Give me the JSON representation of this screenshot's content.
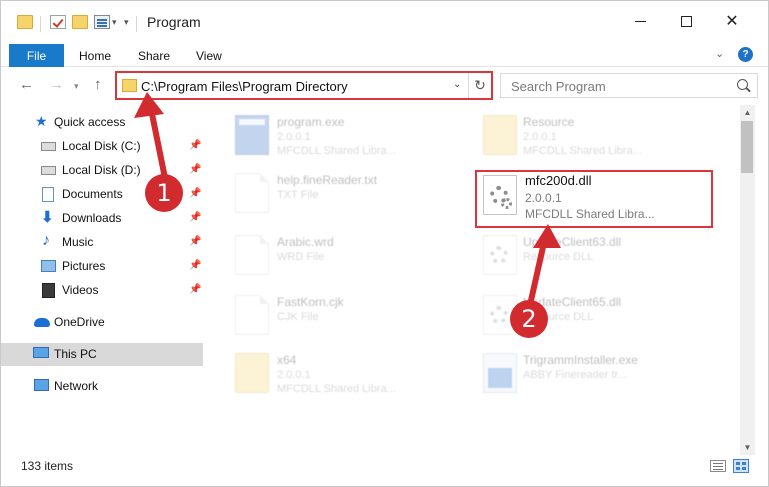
{
  "titlebar": {
    "title": "Program",
    "qa_dropdown": "▾"
  },
  "ribbon": {
    "tabs": [
      "File",
      "Home",
      "Share",
      "View"
    ],
    "help": "?"
  },
  "address": {
    "path": "C:\\Program Files\\Program Directory",
    "search_placeholder": "Search Program"
  },
  "sidebar": {
    "items": [
      {
        "label": "Quick access",
        "icon": "star-icon",
        "pinned": false
      },
      {
        "label": "Local Disk (C:)",
        "icon": "drive-icon",
        "pinned": true
      },
      {
        "label": "Local Disk (D:)",
        "icon": "drive-icon",
        "pinned": true
      },
      {
        "label": "Documents",
        "icon": "documents-icon",
        "pinned": true
      },
      {
        "label": "Downloads",
        "icon": "download-icon",
        "pinned": true
      },
      {
        "label": "Music",
        "icon": "music-icon",
        "pinned": true
      },
      {
        "label": "Pictures",
        "icon": "pictures-icon",
        "pinned": true
      },
      {
        "label": "Videos",
        "icon": "videos-icon",
        "pinned": true
      },
      {
        "label": "OneDrive",
        "icon": "cloud-icon",
        "pinned": false
      },
      {
        "label": "This PC",
        "icon": "computer-icon",
        "pinned": false,
        "selected": true
      },
      {
        "label": "Network",
        "icon": "network-icon",
        "pinned": false
      }
    ]
  },
  "files": [
    {
      "name": "program.exe",
      "meta1": "2.0.0.1",
      "meta2": "MFCDLL Shared Libra...",
      "icon": "exe-icon"
    },
    {
      "name": "Resource",
      "meta1": "2.0.0.1",
      "meta2": "MFCDLL Shared Libra...",
      "icon": "folder-icon"
    },
    {
      "name": "help.fineReader.txt",
      "meta1": "TXT File",
      "meta2": "",
      "icon": "document-icon"
    },
    {
      "name": "mfc200d.dll",
      "meta1": "2.0.0.1",
      "meta2": "MFCDLL Shared Libra...",
      "icon": "dll-gear-icon",
      "highlighted": true
    },
    {
      "name": "Arabic.wrd",
      "meta1": "WRD File",
      "meta2": "",
      "icon": "document-icon"
    },
    {
      "name": "UpdateClient63.dll",
      "meta1": "Resource DLL",
      "meta2": "",
      "icon": "dll-gear-icon"
    },
    {
      "name": "FastKorn.cjk",
      "meta1": "CJK File",
      "meta2": "",
      "icon": "document-icon"
    },
    {
      "name": "UpdateClient65.dll",
      "meta1": "Resource DLL",
      "meta2": "",
      "icon": "dll-gear-icon"
    },
    {
      "name": "x64",
      "meta1": "2.0.0.1",
      "meta2": "MFCDLL Shared Libra...",
      "icon": "folder-icon"
    },
    {
      "name": "TrigrammInstaller.exe",
      "meta1": "ABBY Finereader tr...",
      "meta2": "",
      "icon": "installer-icon"
    }
  ],
  "status": {
    "count": "133 items"
  },
  "callouts": [
    "1",
    "2"
  ],
  "colors": {
    "accent": "#1979ca",
    "highlight": "#d9363e",
    "callout": "#d12a2f"
  }
}
